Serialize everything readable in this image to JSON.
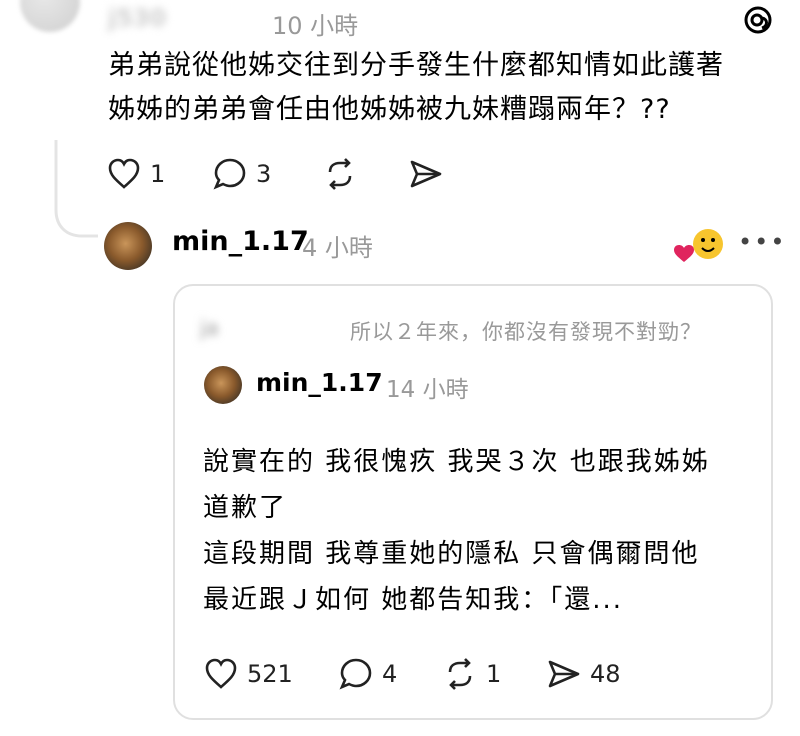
{
  "post": {
    "username": "j530",
    "time": "10 小時",
    "text_lines": [
      "弟弟說從他姊交往到分手發生什麼都知情如此護著",
      "姊姊的弟弟會任由他姊姊被九妹糟蹋兩年？??"
    ],
    "likes": "1",
    "comments": "3"
  },
  "reply": {
    "username": "min_1.17",
    "time": "4 小時",
    "icons": [
      "heart-icon",
      "smiley-sticker-icon",
      "more-icon"
    ]
  },
  "quote": {
    "reply_to_user": "ja",
    "reply_to_text": "所以２年來，你都沒有發現不對勁？",
    "username": "min_1.17",
    "time": "14 小時",
    "text_lines": [
      "說實在的 我很愧疚 我哭３次 也跟我姊姊",
      "道歉了",
      "這段期間 我尊重她的隱私 只會偶爾問他",
      "最近跟Ｊ如何 她都告知我：「還..."
    ],
    "likes": "521",
    "comments": "4",
    "reposts": "1",
    "shares": "48"
  },
  "colors": {
    "text": "#000000",
    "muted": "#999999",
    "heart": "#e0245e",
    "sticker": "#f7c52e"
  }
}
